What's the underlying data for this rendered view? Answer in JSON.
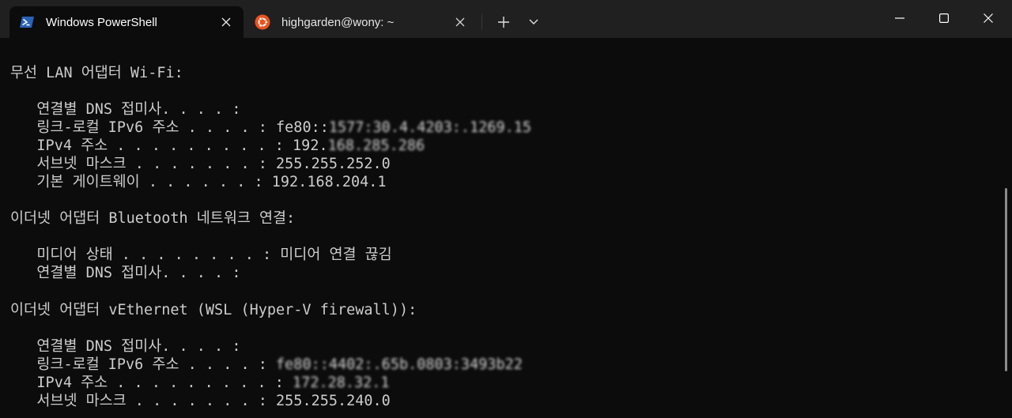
{
  "tabs": [
    {
      "title": "Windows PowerShell",
      "icon": "powershell-icon",
      "active": true
    },
    {
      "title": "highgarden@wony: ~",
      "icon": "ubuntu-icon",
      "active": false
    }
  ],
  "colors": {
    "terminal_bg": "#0c0c0c",
    "titlebar_bg": "#202020",
    "text": "#cccccc",
    "powershell_blue": "#2a62b6",
    "ubuntu_orange": "#e95420"
  },
  "terminal": {
    "lines": [
      {
        "text": "무선 LAN 어댑터 Wi-Fi:"
      },
      {
        "text": ""
      },
      {
        "text": "   연결별 DNS 접미사. . . . :"
      },
      {
        "text": "   링크-로컬 IPv6 주소 . . . . : ",
        "value": "fe80::",
        "masked": "1577:30.4.4203:.1269.15"
      },
      {
        "text": "   IPv4 주소 . . . . . . . . . : ",
        "value": "192.",
        "masked": "168.285.286"
      },
      {
        "text": "   서브넷 마스크 . . . . . . . : ",
        "value": "255.255.252.0"
      },
      {
        "text": "   기본 게이트웨이 . . . . . . : ",
        "value": "192.168.204.1"
      },
      {
        "text": ""
      },
      {
        "text": "이더넷 어댑터 Bluetooth 네트워크 연결:"
      },
      {
        "text": ""
      },
      {
        "text": "   미디어 상태 . . . . . . . . : ",
        "value": "미디어 연결 끊김"
      },
      {
        "text": "   연결별 DNS 접미사. . . . :"
      },
      {
        "text": ""
      },
      {
        "text": "이더넷 어댑터 vEthernet (WSL (Hyper-V firewall)):"
      },
      {
        "text": ""
      },
      {
        "text": "   연결별 DNS 접미사. . . . :"
      },
      {
        "text": "   링크-로컬 IPv6 주소 . . . . : ",
        "masked": "fe80::4402:.65b.0803:3493b22"
      },
      {
        "text": "   IPv4 주소 . . . . . . . . . : ",
        "masked": "172.28.32.1"
      },
      {
        "text": "   서브넷 마스크 . . . . . . . : ",
        "value": "255.255.240.0"
      }
    ]
  }
}
